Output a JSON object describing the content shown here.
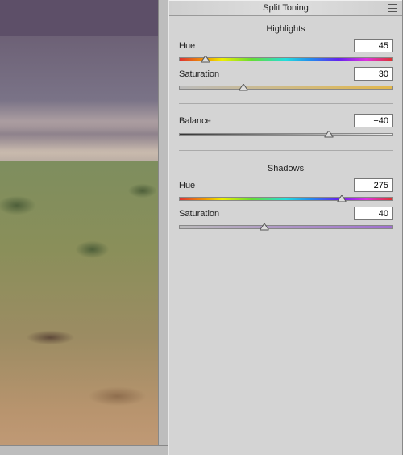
{
  "panel": {
    "title": "Split Toning"
  },
  "sections": {
    "highlights": {
      "title": "Highlights",
      "hue": {
        "label": "Hue",
        "value": "45",
        "pos": 12.5
      },
      "saturation": {
        "label": "Saturation",
        "value": "30",
        "pos": 30.0
      }
    },
    "balance": {
      "label": "Balance",
      "value": "+40",
      "pos": 70.0
    },
    "shadows": {
      "title": "Shadows",
      "hue": {
        "label": "Hue",
        "value": "275",
        "pos": 76.4
      },
      "saturation": {
        "label": "Saturation",
        "value": "40",
        "pos": 40.0
      }
    }
  }
}
